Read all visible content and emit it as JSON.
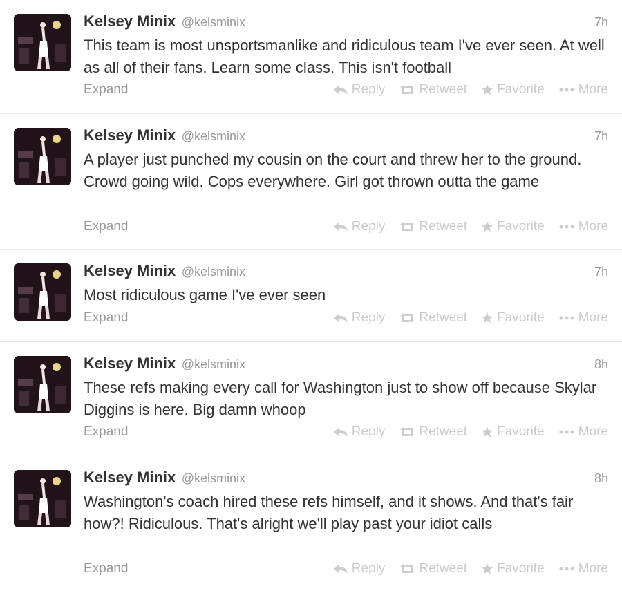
{
  "tweets": [
    {
      "name": "Kelsey Minix",
      "handle": "@kelsminix",
      "time": "7h",
      "text": "This team is most unsportsmanlike and ridiculous team I've ever seen. At well as all of their fans. Learn some class. This isn't football",
      "expand": "Expand",
      "reply": "Reply",
      "retweet": "Retweet",
      "favorite": "Favorite",
      "more": "More"
    },
    {
      "name": "Kelsey Minix",
      "handle": "@kelsminix",
      "time": "7h",
      "text": "A player just punched my cousin on the court and threw her to the ground. Crowd going wild. Cops everywhere. Girl got thrown outta the game",
      "expand": "Expand",
      "reply": "Reply",
      "retweet": "Retweet",
      "favorite": "Favorite",
      "more": "More"
    },
    {
      "name": "Kelsey Minix",
      "handle": "@kelsminix",
      "time": "7h",
      "text": "Most ridiculous game I've ever seen",
      "expand": "Expand",
      "reply": "Reply",
      "retweet": "Retweet",
      "favorite": "Favorite",
      "more": "More"
    },
    {
      "name": "Kelsey Minix",
      "handle": "@kelsminix",
      "time": "8h",
      "text": "These refs making every call for Washington just to show off because Skylar Diggins is here. Big damn whoop",
      "expand": "Expand",
      "reply": "Reply",
      "retweet": "Retweet",
      "favorite": "Favorite",
      "more": "More"
    },
    {
      "name": "Kelsey Minix",
      "handle": "@kelsminix",
      "time": "8h",
      "text": "Washington's coach hired these refs himself, and it shows. And that's fair how?! Ridiculous. That's alright we'll play past your idiot calls",
      "expand": "Expand",
      "reply": "Reply",
      "retweet": "Retweet",
      "favorite": "Favorite",
      "more": "More"
    }
  ],
  "icons": {
    "reply": "reply-arrow-icon",
    "retweet": "retweet-icon",
    "favorite": "star-icon",
    "more": "more-dots-icon"
  },
  "colors": {
    "name": "#333333",
    "secondary": "#999999",
    "action_disabled": "#cccccc",
    "divider": "#e8e8e8"
  }
}
